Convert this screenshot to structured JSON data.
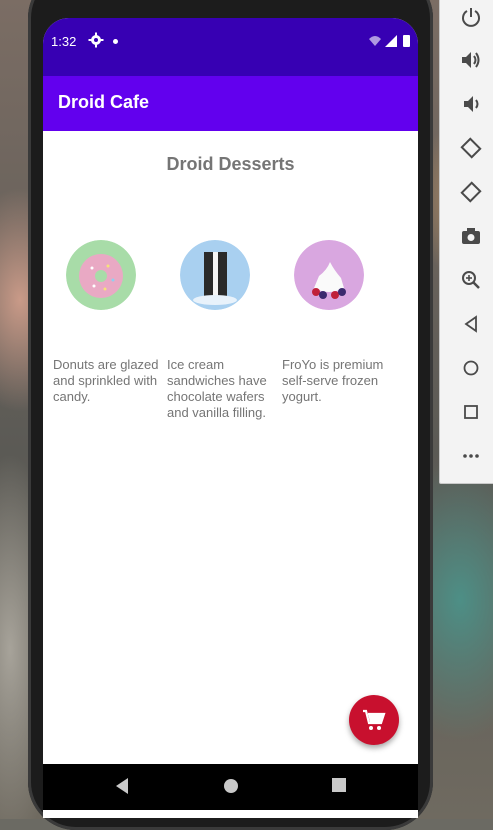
{
  "status_bar": {
    "time": "1:32"
  },
  "app_bar": {
    "title": "Droid Cafe"
  },
  "main": {
    "heading": "Droid Desserts",
    "desserts": [
      {
        "name": "donut",
        "description": "Donuts are glazed and sprinkled with candy."
      },
      {
        "name": "ice-cream-sandwich",
        "description": "Ice cream sandwiches have chocolate wafers and vanilla filling."
      },
      {
        "name": "froyo",
        "description": "FroYo is premium self-serve frozen yogurt."
      }
    ]
  },
  "fab": {
    "icon": "cart-icon",
    "color": "#c8102e"
  },
  "colors": {
    "status_bar": "#3700b3",
    "app_bar": "#6200ee",
    "text_secondary": "#757575"
  },
  "emulator_toolbar": [
    "power-icon",
    "volume-up-icon",
    "volume-down-icon",
    "rotate-left-icon",
    "rotate-right-icon",
    "screenshot-icon",
    "zoom-icon",
    "back-icon",
    "home-icon",
    "overview-icon",
    "more-icon"
  ]
}
